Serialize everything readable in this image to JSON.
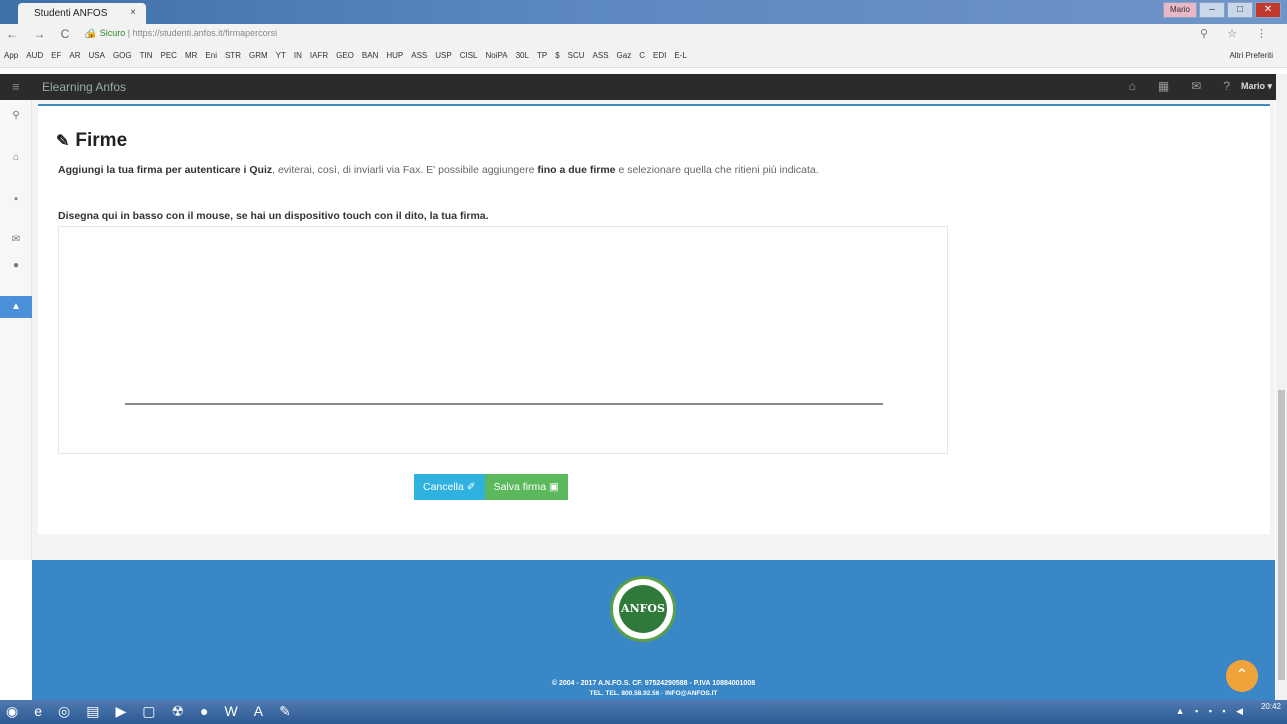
{
  "browser": {
    "tab_title": "Studenti ANFOS",
    "tab_close": "×",
    "window_user": "Mario",
    "nav_glyphs": "← → C ⌂",
    "secure_label": "Sicuro",
    "url": "https://studenti.anfos.it/firmapercorsi",
    "right_glyphs": "⚲ ☆ ⋮",
    "bookmarks": [
      "App",
      "AUD",
      "EF",
      "AR",
      "USA",
      "GOG",
      "TIN",
      "PEC",
      "MR",
      "Eni",
      "STR",
      "GRM",
      "YT",
      "IN",
      "IAFR",
      "GEO",
      "BAN",
      "HUP",
      "ASS",
      "USP",
      "CISL",
      "NoiPA",
      "30L",
      "TP",
      "$",
      "SCU",
      "ASS",
      "Gaz",
      "C",
      "EDI",
      "E-L"
    ],
    "other_bookmarks": "Altri Preferiti"
  },
  "appnav": {
    "brand": "Elearning Anfos",
    "user_menu": "Mario ▾"
  },
  "page": {
    "title": "Firme",
    "lead_part1": "Aggiungi la tua firma per autenticare i Quiz",
    "lead_part2": ", eviterai, così, di inviarli via Fax. E' possibile aggiungere ",
    "lead_part3": "fino a due firme",
    "lead_part4": " e selezionare quella che ritieni più indicata.",
    "instruction": "Disegna qui in basso con il mouse, se hai un dispositivo touch con il dito, la tua firma.",
    "cancel_label": "Cancella",
    "save_label": "Salva firma"
  },
  "footer": {
    "logo_text": "ANFOS",
    "copyright": "© 2004 - 2017 A.N.FO.S. CF. 97524290588 - P.IVA 10884001008",
    "contacts": "TEL. TEL. 800.58.92.56 · INFO@ANFOS.IT"
  },
  "taskbar": {
    "time": "20:42"
  },
  "colors": {
    "accent": "#3c8dbc",
    "cancel": "#2fb2df",
    "save": "#5cb85c",
    "footer": "#3a87c8",
    "scrolltop": "#f0a33a"
  }
}
